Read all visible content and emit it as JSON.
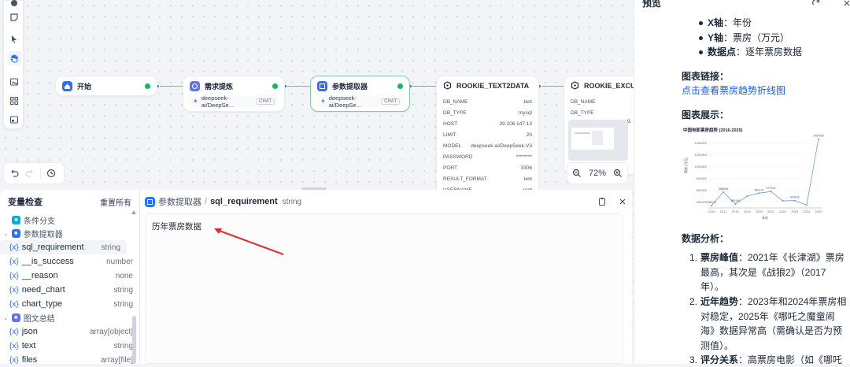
{
  "canvas": {
    "nodes": {
      "start": {
        "title": "开始"
      },
      "req": {
        "title": "需求提炼",
        "model": "deepseek-ai/DeepSe...",
        "badge": "CHAT"
      },
      "param": {
        "title": "参数提取器",
        "model": "deepseek-ai/DeepSe...",
        "badge": "CHAT"
      },
      "text2data": {
        "title": "ROOKIE_TEXT2DATA",
        "rows": [
          {
            "k": "DB_NAME",
            "v": "test"
          },
          {
            "k": "DB_TYPE",
            "v": "mysql"
          },
          {
            "k": "HOST",
            "v": "39.106.147.13"
          },
          {
            "k": "LIMIT",
            "v": "20"
          },
          {
            "k": "MODEL",
            "v": "deepseek-ai/DeepSeek-V3"
          },
          {
            "k": "PASSWORD",
            "v": "********"
          },
          {
            "k": "PORT",
            "v": "3306"
          },
          {
            "k": "RESULT_FORMAT",
            "v": "text"
          },
          {
            "k": "USERNAME",
            "v": "root"
          }
        ]
      },
      "excute": {
        "title": "ROOKIE_EXCUTE_S",
        "rows": [
          {
            "k": "DB_NAME",
            "v": ""
          },
          {
            "k": "DB_TYPE",
            "v": ""
          }
        ],
        "partial": "9."
      }
    },
    "zoom": "72%"
  },
  "vars": {
    "title": "变量检查",
    "reset": "重置所有",
    "groups": [
      {
        "name": "条件分支",
        "color": "#06aed4",
        "items": []
      },
      {
        "name": "参数提取器",
        "color": "#2970ff",
        "items": [
          {
            "name": "sql_requirement",
            "type": "string"
          },
          {
            "name": "__is_success",
            "type": "number"
          },
          {
            "name": "__reason",
            "type": "none"
          },
          {
            "name": "need_chart",
            "type": "string"
          },
          {
            "name": "chart_type",
            "type": "string"
          }
        ]
      },
      {
        "name": "图文总结",
        "color": "#6172f3",
        "items": [
          {
            "name": "json",
            "type": "array[object]"
          },
          {
            "name": "text",
            "type": "string"
          },
          {
            "name": "files",
            "type": "array[file]"
          }
        ]
      }
    ],
    "x_glyph": "{x}"
  },
  "editor": {
    "node": "参数提取器",
    "sep": "/",
    "var": "sql_requirement",
    "type": "string",
    "value": "历年票房数据"
  },
  "preview": {
    "title": "预览",
    "bullets": [
      {
        "bold": "X轴",
        "rest": "：年份"
      },
      {
        "bold": "Y轴",
        "rest": "：票房（万元）"
      },
      {
        "bold": "数据点",
        "rest": "：逐年票房数据"
      }
    ],
    "link_heading": "图表链接",
    "link_colon": "：",
    "link_text": "点击查看票房趋势折线图",
    "chart_heading": "图表展示",
    "analysis_heading": "数据分析",
    "analysis": [
      {
        "n": "1.",
        "bold": "票房峰值",
        "rest": "：2021年《长津湖》票房最高，其次是《战狼2》（2017年）。"
      },
      {
        "n": "2.",
        "bold": "近年趋势",
        "rest": "：2023年和2024年票房相对稳定，2025年《哪吒之魔童闹海》数据异常高（需确认是否为预测值）。"
      },
      {
        "n": "3.",
        "bold": "评分关系",
        "rest": "：高票房电影（如《哪吒"
      }
    ]
  },
  "chart_data": {
    "type": "line",
    "title": "中国电影票房趋势 (2016-2025)",
    "xlabel": "年份",
    "ylabel": "票房 (万元)",
    "x": [
      "2016",
      "2017",
      "2018",
      "2019",
      "2020",
      "2021",
      "2022",
      "2023",
      "2024",
      "2025"
    ],
    "yticks": [
      "1400000",
      "1200000",
      "1000000",
      "800000",
      "600000",
      "400000"
    ],
    "ylim": [
      300000,
      1500000
    ],
    "series": [
      {
        "values": [
          339211,
          568006,
          365149,
          500000,
          549174,
          577514,
          419500,
          424142,
          348630,
          1467520
        ]
      }
    ],
    "point_labels": [
      "339211",
      "568006",
      "365149",
      "549174",
      "577514",
      "424142",
      "1467520"
    ]
  },
  "colors": {
    "accent": "#2970ff",
    "ok": "#12b76a",
    "link": "#155eef",
    "arrow": "#e0302d"
  }
}
